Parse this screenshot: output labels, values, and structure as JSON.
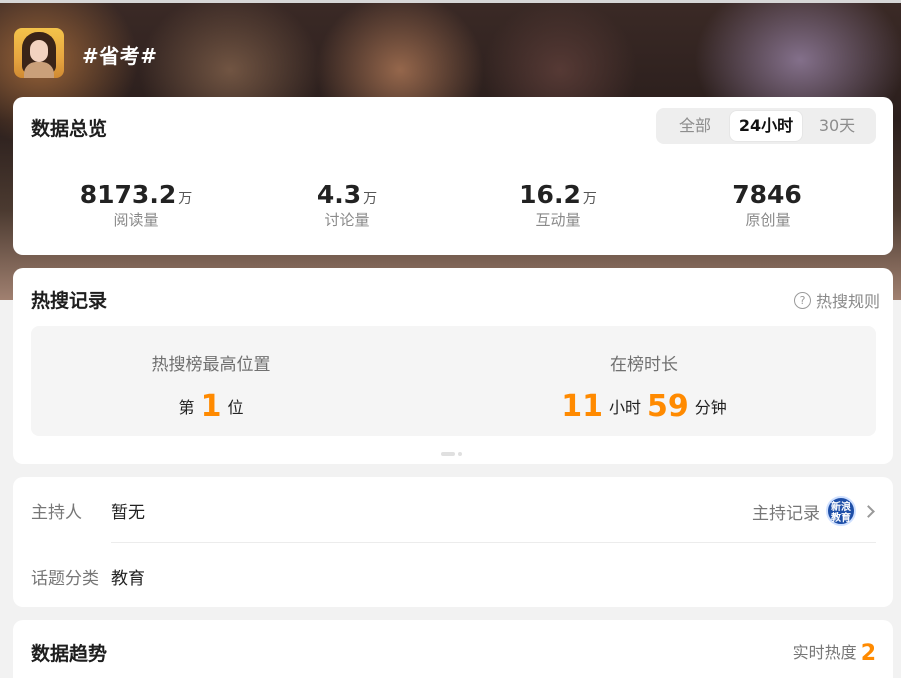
{
  "topic": {
    "title": "#省考#"
  },
  "overview": {
    "title": "数据总览",
    "tabs": [
      "全部",
      "24小时",
      "30天"
    ],
    "active_tab": "24小时",
    "stats": [
      {
        "value": "8173.2",
        "unit": "万",
        "label": "阅读量"
      },
      {
        "value": "4.3",
        "unit": "万",
        "label": "讨论量"
      },
      {
        "value": "16.2",
        "unit": "万",
        "label": "互动量"
      },
      {
        "value": "7846",
        "unit": "",
        "label": "原创量"
      }
    ]
  },
  "hot_search": {
    "title": "热搜记录",
    "rules_label": "热搜规则",
    "rules_icon": "help-icon",
    "best_position_label": "热搜榜最高位置",
    "best_position_prefix": "第",
    "best_position_value": "1",
    "best_position_suffix": "位",
    "duration_label": "在榜时长",
    "duration_hours": "11",
    "duration_hours_unit": "小时",
    "duration_minutes": "59",
    "duration_minutes_unit": "分钟"
  },
  "info": {
    "host_label": "主持人",
    "host_value": "暂无",
    "host_record_label": "主持记录",
    "host_badge": "新浪教育",
    "category_label": "话题分类",
    "category_value": "教育"
  },
  "trend": {
    "title": "数据趋势",
    "heat_label": "实时热度",
    "heat_value": "2"
  },
  "colors": {
    "accent": "#ff8a00",
    "badge": "#1e4fa8"
  }
}
